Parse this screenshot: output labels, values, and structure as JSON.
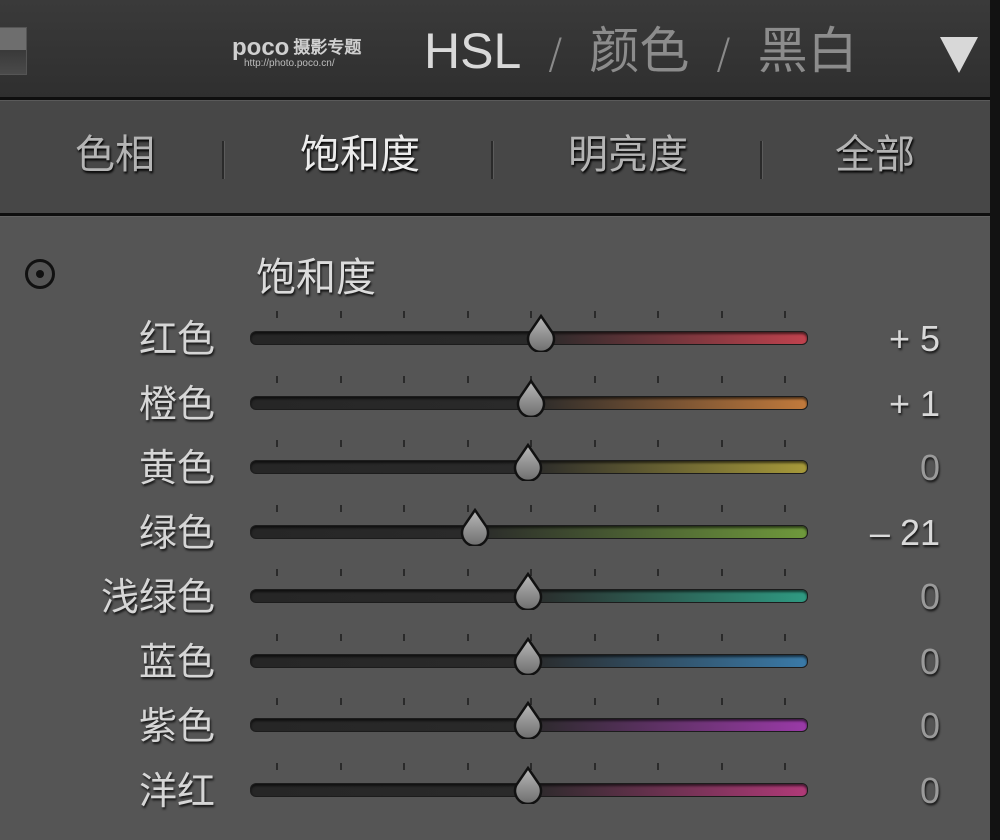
{
  "header": {
    "logo_text": "poco",
    "logo_subtext": "摄影专题",
    "logo_url": "http://photo.poco.cn/",
    "nav": [
      {
        "label": "HSL",
        "active": true
      },
      {
        "label": "颜色",
        "active": false
      },
      {
        "label": "黑白",
        "active": false
      }
    ],
    "separator": "/",
    "collapse_icon": "triangle-down-icon"
  },
  "tabs": [
    {
      "label": "色相",
      "active": false
    },
    {
      "label": "饱和度",
      "active": true
    },
    {
      "label": "明亮度",
      "active": false
    },
    {
      "label": "全部",
      "active": false
    }
  ],
  "panel": {
    "title": "饱和度",
    "target_tool_icon": "target-adjustment-icon",
    "slider_min": -100,
    "slider_max": 100,
    "sliders": [
      {
        "label": "红色",
        "value": 5,
        "display": "+ 5",
        "color": "#c0424e"
      },
      {
        "label": "橙色",
        "value": 1,
        "display": "+ 1",
        "color": "#c27a3c"
      },
      {
        "label": "黄色",
        "value": 0,
        "display": "0",
        "color": "#a79a3a"
      },
      {
        "label": "绿色",
        "value": -21,
        "display": "– 21",
        "color": "#6f9a3c"
      },
      {
        "label": "浅绿色",
        "value": 0,
        "display": "0",
        "color": "#2f9a82"
      },
      {
        "label": "蓝色",
        "value": 0,
        "display": "0",
        "color": "#3a7aa8"
      },
      {
        "label": "紫色",
        "value": 0,
        "display": "0",
        "color": "#9a3aa8"
      },
      {
        "label": "洋红",
        "value": 0,
        "display": "0",
        "color": "#b03a78"
      }
    ]
  }
}
